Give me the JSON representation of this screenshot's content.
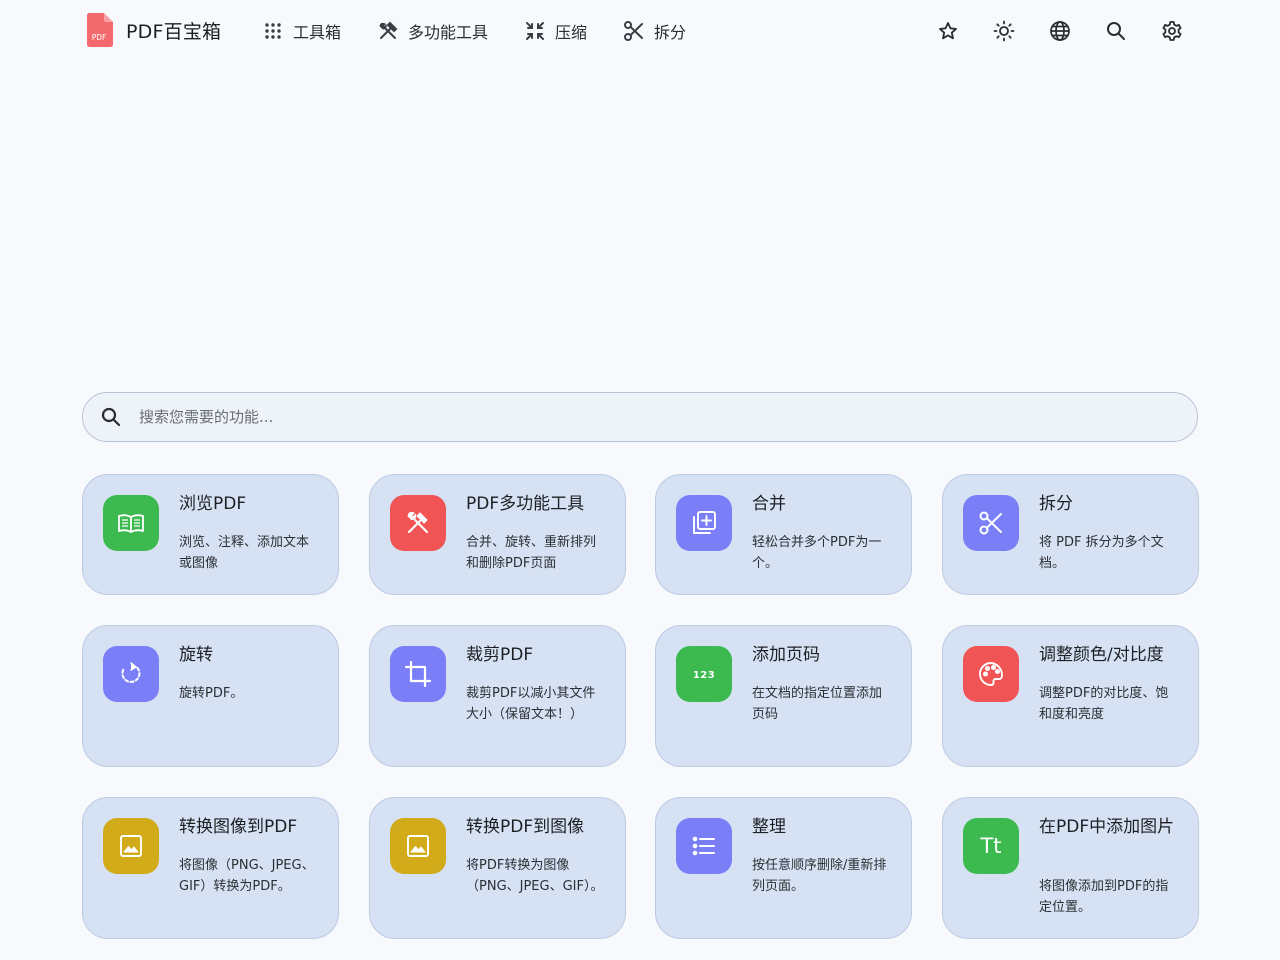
{
  "brand": {
    "name": "PDF百宝箱",
    "logo_text": "PDF",
    "logo_color": "#f2555a"
  },
  "nav": [
    {
      "label": "工具箱",
      "icon": "grid-dots-icon"
    },
    {
      "label": "多功能工具",
      "icon": "tools-icon"
    },
    {
      "label": "压缩",
      "icon": "compress-icon"
    },
    {
      "label": "拆分",
      "icon": "scissors-icon"
    }
  ],
  "actions": [
    "star-icon",
    "sun-icon",
    "globe-icon",
    "search-icon",
    "gear-icon"
  ],
  "search": {
    "placeholder": "搜索您需要的功能..."
  },
  "cards": [
    {
      "title": "浏览PDF",
      "desc": "浏览、注释、添加文本或图像",
      "icon": "book-icon",
      "color": "#3dba4f"
    },
    {
      "title": "PDF多功能工具",
      "desc": "合并、旋转、重新排列和删除PDF页面",
      "icon": "tools-icon",
      "color": "#f05454"
    },
    {
      "title": "合并",
      "desc": "轻松合并多个PDF为一个。",
      "icon": "merge-icon",
      "color": "#7a7ff7"
    },
    {
      "title": "拆分",
      "desc": "将 PDF 拆分为多个文档。",
      "icon": "scissors-icon",
      "color": "#7a7ff7"
    },
    {
      "title": "旋转",
      "desc": "旋转PDF。",
      "icon": "rotate-icon",
      "color": "#7a7ff7"
    },
    {
      "title": "裁剪PDF",
      "desc": "裁剪PDF以减小其文件大小（保留文本！）",
      "icon": "crop-icon",
      "color": "#7a7ff7"
    },
    {
      "title": "添加页码",
      "desc": "在文档的指定位置添加页码",
      "icon": "page-number-icon",
      "icon_text": "123",
      "color": "#3dba4f"
    },
    {
      "title": "调整颜色/对比度",
      "desc": "调整PDF的对比度、饱和度和亮度",
      "icon": "palette-icon",
      "color": "#f05454"
    },
    {
      "title": "转换图像到PDF",
      "desc": "将图像（PNG、JPEG、GIF）转换为PDF。",
      "icon": "image-icon",
      "color": "#d2ab1a"
    },
    {
      "title": "转换PDF到图像",
      "desc": "将PDF转换为图像（PNG、JPEG、GIF）。",
      "icon": "image-icon",
      "color": "#d2ab1a"
    },
    {
      "title": "整理",
      "desc": "按任意顺序删除/重新排列页面。",
      "icon": "list-icon",
      "color": "#7a7ff7"
    },
    {
      "title": "在PDF中添加图片",
      "desc": "将图像添加到PDF的指定位置。",
      "icon": "text-size-icon",
      "icon_text": "Tt",
      "color": "#3dba4f"
    }
  ]
}
